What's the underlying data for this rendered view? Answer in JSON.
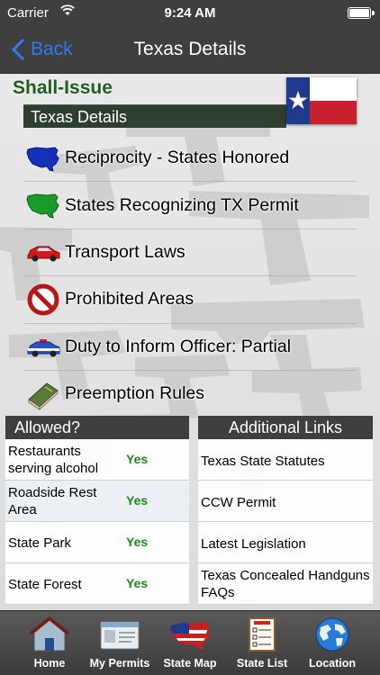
{
  "status_bar": {
    "carrier": "Carrier",
    "time": "9:24 AM"
  },
  "nav": {
    "back_label": "Back",
    "title": "Texas Details"
  },
  "header": {
    "status": "Shall-Issue",
    "section": "Texas Details",
    "flag_icon": "texas-flag-icon"
  },
  "menu": [
    {
      "label": "Reciprocity - States Honored",
      "icon": "us-map-blue-icon"
    },
    {
      "label": "States Recognizing TX Permit",
      "icon": "us-map-green-icon"
    },
    {
      "label": "Transport Laws",
      "icon": "red-car-icon"
    },
    {
      "label": "Prohibited Areas",
      "icon": "prohibited-icon"
    },
    {
      "label": "Duty to Inform Officer: Partial",
      "icon": "police-car-icon"
    },
    {
      "label": "Preemption Rules",
      "icon": "law-book-icon"
    }
  ],
  "allowed": {
    "heading": "Allowed?",
    "rows": [
      {
        "place": "Restaurants serving alcohol",
        "value": "Yes"
      },
      {
        "place": "Roadside Rest Area",
        "value": "Yes"
      },
      {
        "place": "State Park",
        "value": "Yes"
      },
      {
        "place": "State Forest",
        "value": "Yes"
      }
    ]
  },
  "links": {
    "heading": "Additional Links",
    "rows": [
      {
        "label": "Texas State Statutes"
      },
      {
        "label": "CCW Permit"
      },
      {
        "label": "Latest Legislation"
      },
      {
        "label": "Texas Concealed Handguns FAQs"
      }
    ]
  },
  "tabs": [
    {
      "label": "Home",
      "icon": "home-icon"
    },
    {
      "label": "My Permits",
      "icon": "permit-card-icon"
    },
    {
      "label": "State Map",
      "icon": "us-flag-map-icon"
    },
    {
      "label": "State List",
      "icon": "state-list-icon"
    },
    {
      "label": "Location",
      "icon": "globe-icon"
    }
  ],
  "colors": {
    "accent": "#2d7cf6",
    "status_green": "#1f5e1f",
    "yes_green": "#1c8a1c",
    "bar": "#3f3f3f"
  }
}
